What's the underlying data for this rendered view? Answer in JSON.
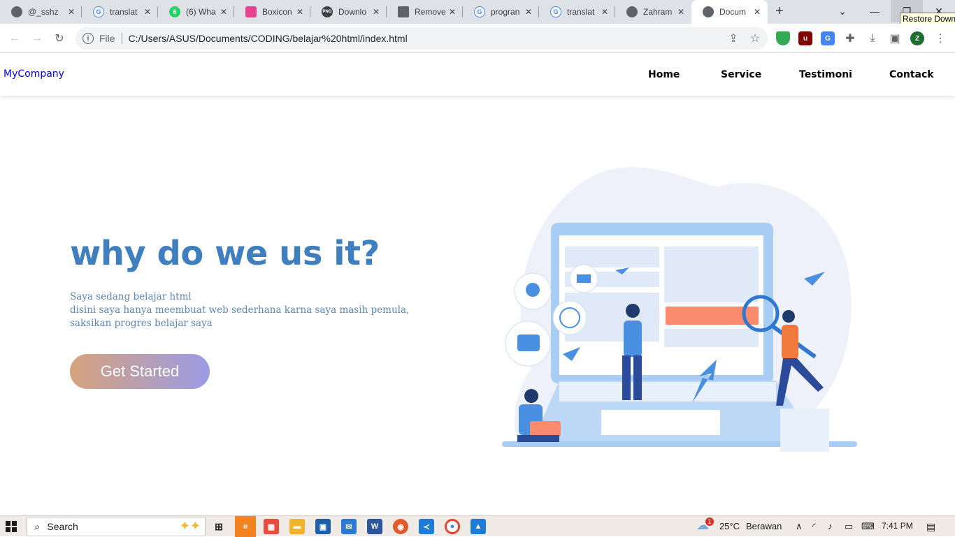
{
  "browser": {
    "tabs": [
      {
        "title": "@_sshz",
        "favicon_color": "#5f6368"
      },
      {
        "title": "translat",
        "favicon_color": "#4285f4"
      },
      {
        "title": "(6) Wha",
        "favicon_color": "#25d366",
        "favicon_text": "6"
      },
      {
        "title": "Boxicon",
        "favicon_color": "#e84393"
      },
      {
        "title": "Downlo",
        "favicon_color": "#3c4043",
        "favicon_text": "PNG"
      },
      {
        "title": "Remove",
        "favicon_color": "#5f6368"
      },
      {
        "title": "progran",
        "favicon_color": "#4285f4"
      },
      {
        "title": "translat",
        "favicon_color": "#4285f4"
      },
      {
        "title": "Zahram",
        "favicon_color": "#5f6368"
      },
      {
        "title": "Docum",
        "favicon_color": "#5f6368",
        "active": true
      }
    ],
    "new_tab_label": "+",
    "tooltip": "Restore Down",
    "url_scheme_label": "File",
    "url": "C:/Users/ASUS/Documents/CODING/belajar%20html/index.html",
    "profile_initial": "Z"
  },
  "page": {
    "brand": "MyCompany",
    "nav": [
      "Home",
      "Service",
      "Testimoni",
      "Contack"
    ],
    "hero_title": "why do we us it?",
    "hero_lines": [
      "Saya sedang belajar html",
      "disini saya hanya meembuat web sederhana karna saya masih pemula,",
      "saksikan progres belajar saya"
    ],
    "cta_label": "Get Started",
    "colors": {
      "title": "#3f7fbf",
      "text": "#5b86b8",
      "cta_start": "#d6a27c",
      "cta_end": "#9b9be6",
      "brand_link": "#0000ee"
    }
  },
  "taskbar": {
    "search_label": "Search",
    "weather_badge": "1",
    "temperature": "25°C",
    "weather_text": "Berawan",
    "time": "7:41 PM"
  }
}
